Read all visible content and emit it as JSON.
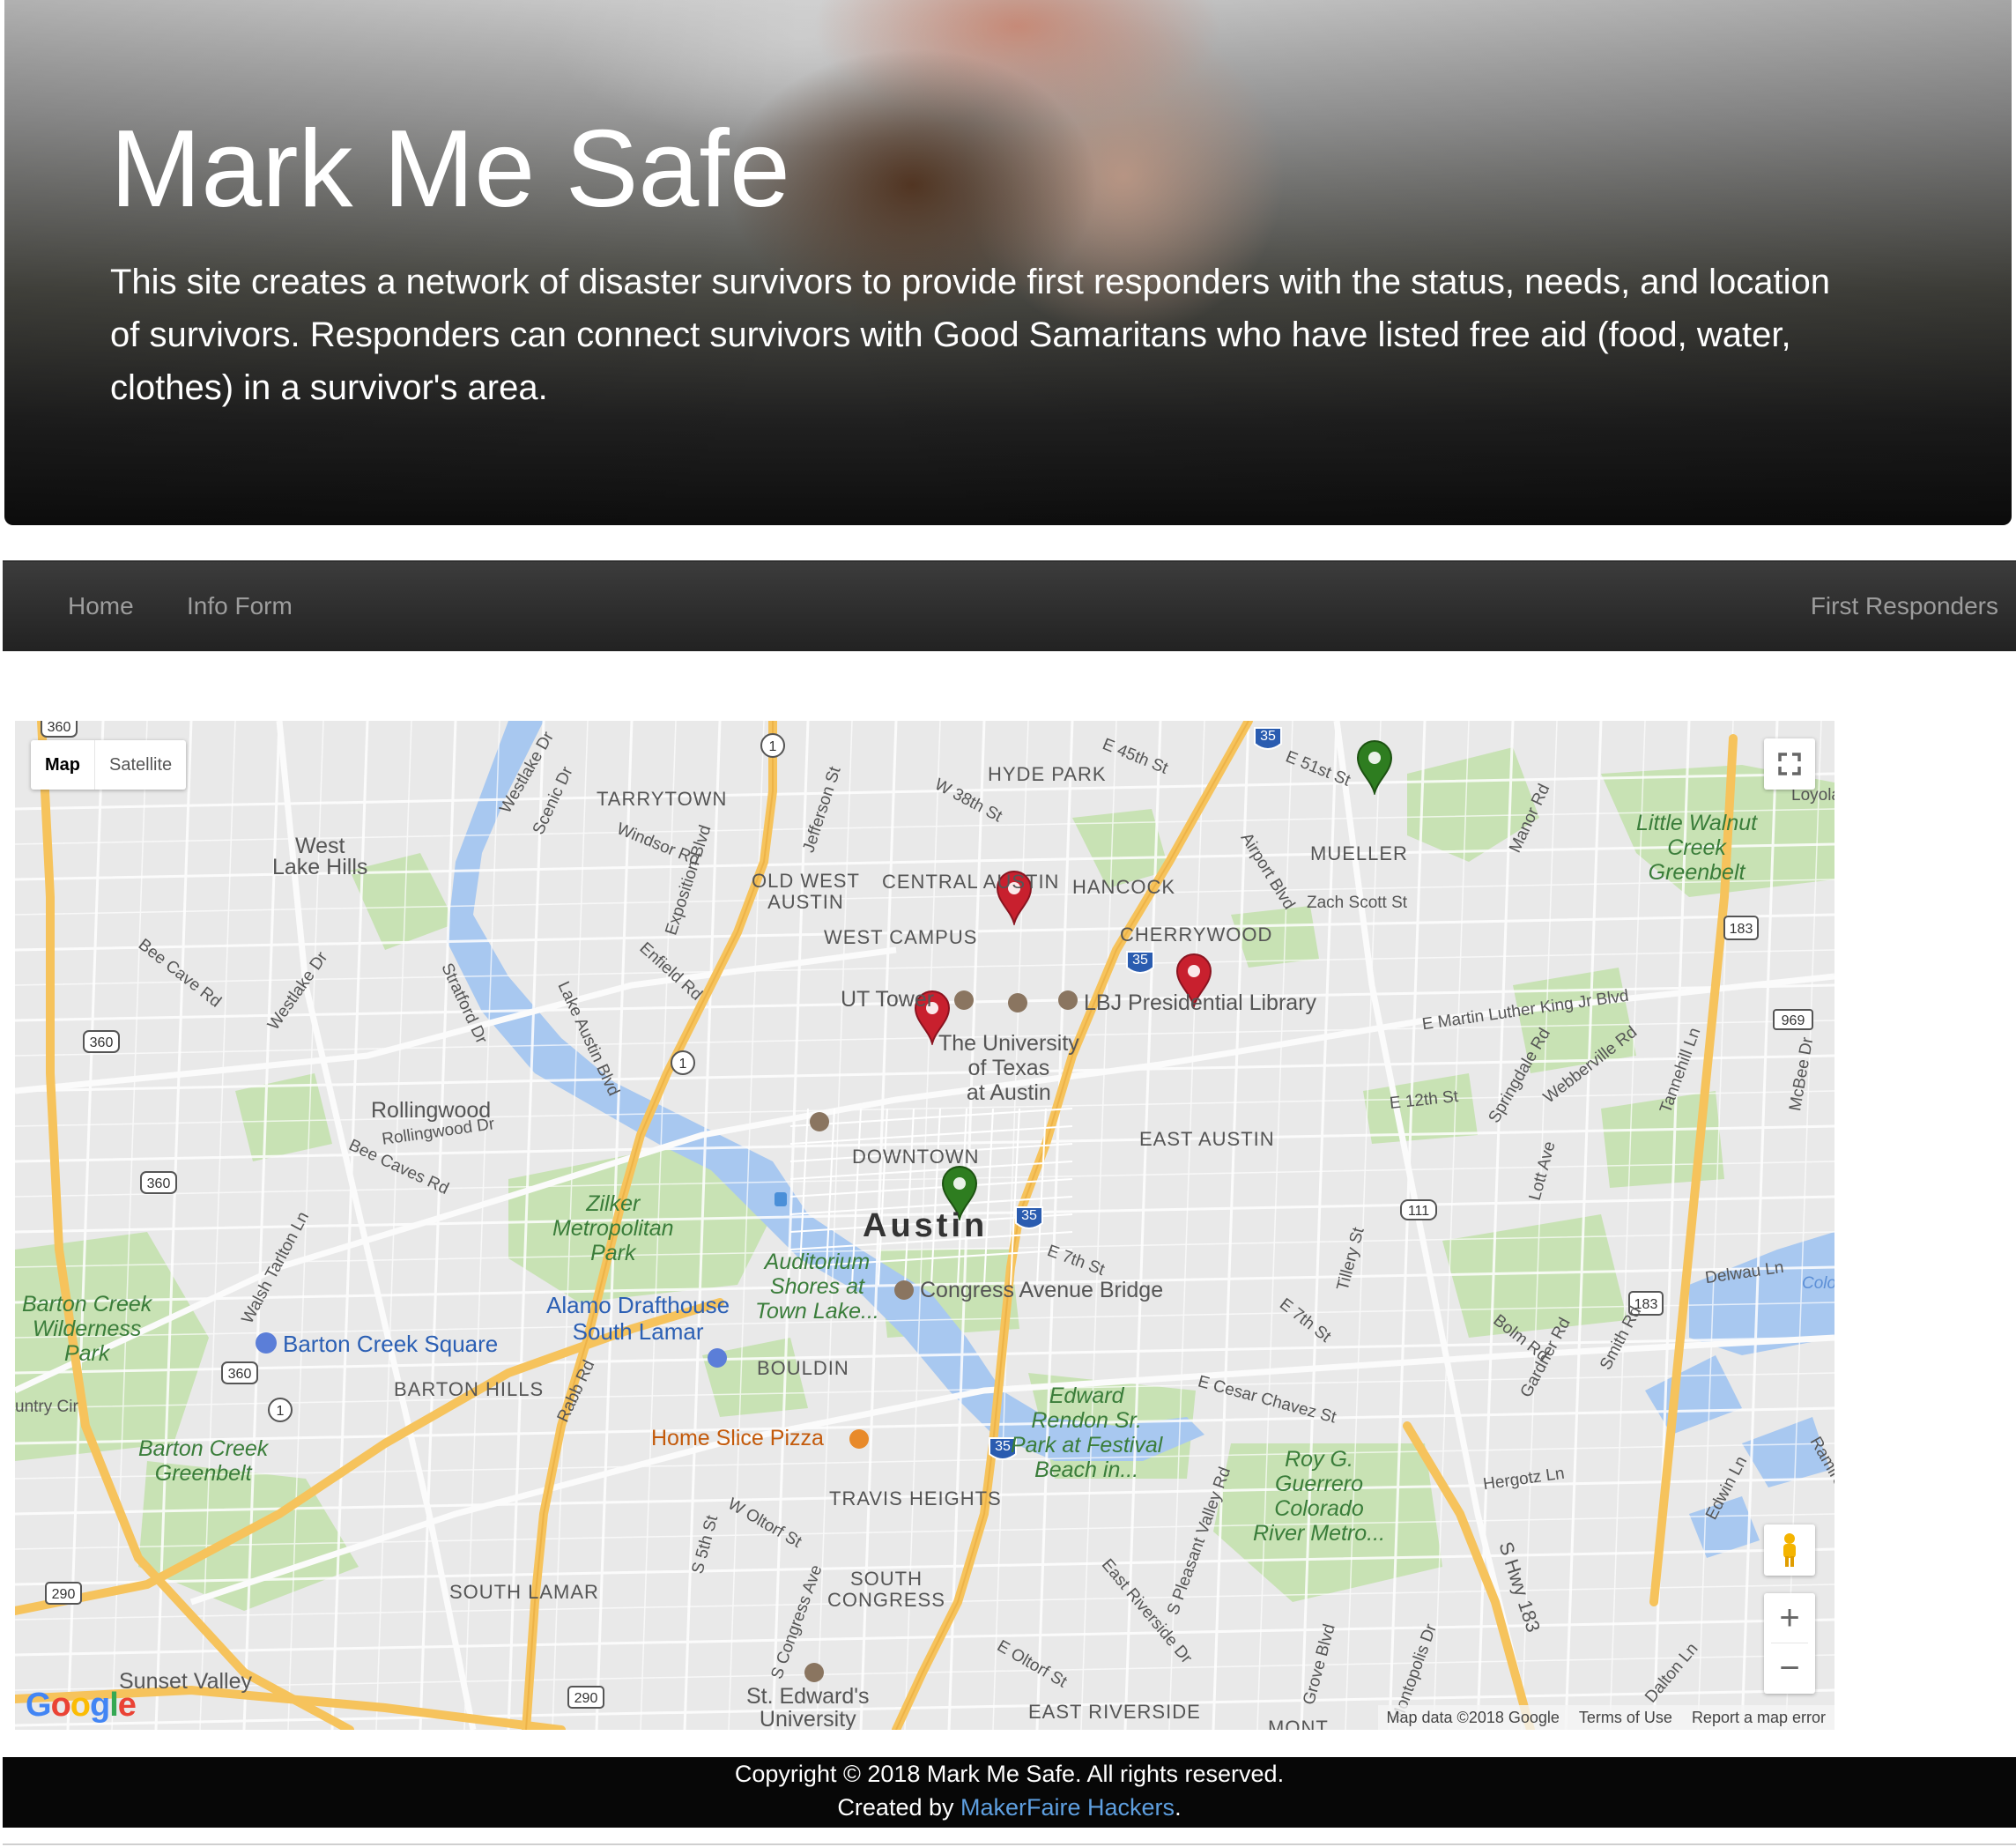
{
  "hero": {
    "title": "Mark Me Safe",
    "description": "This site creates a network of disaster survivors to provide first responders with the status, needs, and location of survivors. Responders can connect survivors with Good Samaritans who have listed free aid (food, water, clothes) in a survivor's area."
  },
  "nav": {
    "home": "Home",
    "info_form": "Info Form",
    "first_responders": "First Responders"
  },
  "map": {
    "type_map": "Map",
    "type_satellite": "Satellite",
    "city": "Austin",
    "labels": {
      "hyde_park": "HYDE PARK",
      "tarrytown": "TARRYTOWN",
      "west_lake_hills": "West\nLake Hills",
      "mueller": "MUELLER",
      "little_walnut": "Little Walnut\nCreek\nGreenbelt",
      "old_west_austin": "OLD WEST\nAUSTIN",
      "central_austin": "CENTRAL AUSTIN",
      "hancock": "HANCOCK",
      "cherrywood": "CHERRYWOOD",
      "west_campus": "WEST CAMPUS",
      "ut_tower": "UT Tower",
      "lbj_library": "LBJ Presidential Library",
      "ut_austin": "The University\nof Texas\nat Austin",
      "rollingwood": "Rollingwood",
      "east_austin": "EAST AUSTIN",
      "downtown": "DOWNTOWN",
      "zilker": "Zilker\nMetropolitan\nPark",
      "auditorium": "Auditorium\nShores at\nTown Lake...",
      "congress_bridge": "Congress Avenue Bridge",
      "barton_creek_wild": "Barton Creek\nWilderness\nPark",
      "alamo": "Alamo Drafthouse\nSouth Lamar",
      "barton_creek_square": "Barton Creek Square",
      "bouldin": "BOULDIN",
      "barton_hills": "BARTON HILLS",
      "edward_rendon": "Edward\nRendon Sr.\nPark at Festival\nBeach in...",
      "roy_guerrero": "Roy G.\nGuerrero\nColorado\nRiver Metro...",
      "home_slice": "Home Slice Pizza",
      "barton_greenbelt": "Barton Creek\nGreenbelt",
      "travis_heights": "TRAVIS HEIGHTS",
      "south_congress": "SOUTH\nCONGRESS",
      "south_lamar": "SOUTH LAMAR",
      "sunset_valley": "Sunset Valley",
      "st_edwards": "St. Edward's\nUniversity",
      "east_riverside": "EAST RIVERSIDE",
      "mont": "MONT"
    },
    "roads": {
      "e51st": "E 51st St",
      "e45th": "E 45th St",
      "w38th": "W 38th St",
      "airport": "Airport Blvd",
      "zach_scott": "Zach Scott St",
      "manor": "Manor Rd",
      "loyola": "Loyola",
      "windsor": "Windsor Rd",
      "exposition": "Exposition Blvd",
      "jefferson": "Jefferson St",
      "westlake_dr": "Westlake Dr",
      "scenic": "Scenic Dr",
      "enfield": "Enfield Rd",
      "bee_cave": "Bee Cave Rd",
      "westlake_dr2": "Westlake Dr",
      "stratford": "Stratford Dr",
      "lake_austin": "Lake Austin Blvd",
      "mlk": "E Martin Luther King Jr Blvd",
      "springdale": "Springdale Rd",
      "webberville": "Webberville Rd",
      "tannehill": "Tannehill Ln",
      "mcbee": "McBee Dr",
      "e12th": "E 12th St",
      "rollingwood_dr": "Rollingwood Dr",
      "bee_caves": "Bee Caves Rd",
      "lott": "Lott Ave",
      "e7th": "E 7th St",
      "tillery": "Tillery St",
      "delwau": "Delwau Ln",
      "colo": "Colo",
      "walsh": "Walsh Tarlton Ln",
      "e7th_b": "E 7th St",
      "bolm": "Bolm Rd",
      "gardner": "Gardner Rd",
      "smith": "Smith Rd",
      "untry": "untry Cir",
      "rabb": "Rabb Rd",
      "cesar": "E Cesar Chavez St",
      "pleasant_valley": "S Pleasant Valley Rd",
      "hergotz": "Hergotz Ln",
      "edwin": "Edwin Ln",
      "ramirez": "Ramire",
      "w_oltorf": "W Oltorf St",
      "s5th": "S 5th St",
      "s_congress": "S Congress Ave",
      "east_riverside_dr": "East Riverside Dr",
      "s_hwy_183": "S Hwy 183",
      "grove": "Grove Blvd",
      "montopolis": "Montopolis Dr",
      "dalton": "Dalton Ln",
      "e_oltorf": "E Oltorf St"
    },
    "shields": [
      "360",
      "1",
      "35",
      "35",
      "183",
      "969",
      "360",
      "1",
      "360",
      "111",
      "35",
      "183",
      "360",
      "1",
      "35",
      "290",
      "290"
    ],
    "attribution": {
      "data": "Map data ©2018 Google",
      "terms": "Terms of Use",
      "report": "Report a map error"
    },
    "google": [
      "G",
      "o",
      "o",
      "g",
      "l",
      "e"
    ],
    "colors": {
      "marker_red": "#c8202e",
      "marker_green": "#2e7d20",
      "highway": "#f6c35c",
      "water": "#a8c8f0",
      "park": "#c8e2b4"
    }
  },
  "footer": {
    "copyright": "Copyright © 2018 Mark Me Safe. All rights reserved.",
    "created_by": "Created by",
    "link": "MakerFaire Hackers",
    "period": "."
  }
}
